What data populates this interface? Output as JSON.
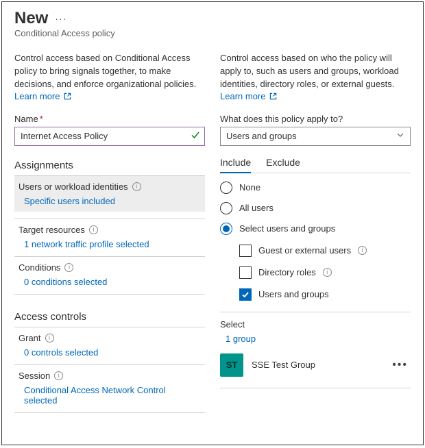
{
  "header": {
    "title": "New",
    "subtitle": "Conditional Access policy"
  },
  "left": {
    "desc": "Control access based on Conditional Access policy to bring signals together, to make decisions, and enforce organizational policies.",
    "learn_more": "Learn more",
    "name_label": "Name",
    "name_value": "Internet Access Policy",
    "assignments_heading": "Assignments",
    "users_label": "Users or workload identities",
    "users_value": "Specific users included",
    "target_label": "Target resources",
    "target_value": "1 network traffic profile selected",
    "conditions_label": "Conditions",
    "conditions_value": "0 conditions selected",
    "access_heading": "Access controls",
    "grant_label": "Grant",
    "grant_value": "0 controls selected",
    "session_label": "Session",
    "session_value": "Conditional Access Network Control selected"
  },
  "right": {
    "desc": "Control access based on who the policy will apply to, such as users and groups, workload identities, directory roles, or external guests.",
    "learn_more": "Learn more",
    "apply_label": "What does this policy apply to?",
    "apply_value": "Users and groups",
    "tab_include": "Include",
    "tab_exclude": "Exclude",
    "opt_none": "None",
    "opt_all": "All users",
    "opt_select": "Select users and groups",
    "cb_guest": "Guest or external users",
    "cb_roles": "Directory roles",
    "cb_ug": "Users and groups",
    "select_label": "Select",
    "select_value": "1 group",
    "group_initials": "ST",
    "group_name": "SSE Test Group"
  }
}
